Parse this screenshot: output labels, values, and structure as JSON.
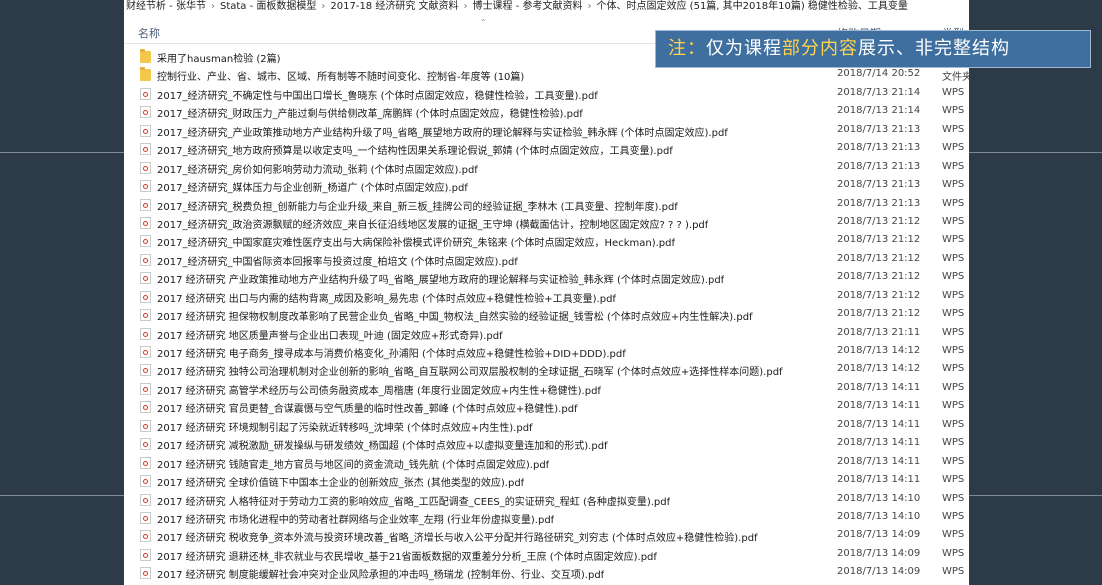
{
  "breadcrumb": [
    "财经节析 - 张华节",
    "Stata - 面板数据模型",
    "2017-18 经济研究 文献资料",
    "博士课程 - 参考文献资料",
    "个体、时点固定效应 (51篇, 其中2018年10篇) 稳健性检验、工具变量"
  ],
  "columns": {
    "name": "名称",
    "date": "修改日期",
    "type": "类型"
  },
  "note": {
    "prefix": "注：",
    "part1": "仅为课程",
    "highlight": "部分内容",
    "part2": "展示、非完整结构"
  },
  "files": [
    {
      "icon": "folder-icon",
      "name": "采用了hausman检验 (2篇)",
      "date": "",
      "type": ""
    },
    {
      "icon": "folder-icon",
      "name": "控制行业、产业、省、城市、区域、所有制等不随时间变化、控制省-年度等 (10篇)",
      "date": "2018/7/14 20:52",
      "type": "文件夹"
    },
    {
      "icon": "pdf-icon",
      "name": "2017_经济研究_不确定性与中国出口增长_鲁晓东 (个体时点固定效应，稳健性检验，工具变量).pdf",
      "date": "2018/7/13 21:14",
      "type": "WPS"
    },
    {
      "icon": "pdf-icon",
      "name": "2017_经济研究_财政压力_产能过剩与供给侧改革_席鹏辉 (个体时点固定效应，稳健性检验).pdf",
      "date": "2018/7/13 21:14",
      "type": "WPS"
    },
    {
      "icon": "pdf-icon",
      "name": "2017_经济研究_产业政策推动地方产业结构升级了吗_省略_展望地方政府的理论解释与实证检验_韩永辉 (个体时点固定效应).pdf",
      "date": "2018/7/13 21:13",
      "type": "WPS"
    },
    {
      "icon": "pdf-icon",
      "name": "2017_经济研究_地方政府预算是以收定支吗_一个结构性因果关系理论假说_郭婧 (个体时点固定效应，工具变量).pdf",
      "date": "2018/7/13 21:13",
      "type": "WPS"
    },
    {
      "icon": "pdf-icon",
      "name": "2017_经济研究_房价如何影响劳动力流动_张莉 (个体时点固定效应).pdf",
      "date": "2018/7/13 21:13",
      "type": "WPS"
    },
    {
      "icon": "pdf-icon",
      "name": "2017_经济研究_媒体压力与企业创新_杨道广 (个体时点固定效应).pdf",
      "date": "2018/7/13 21:13",
      "type": "WPS"
    },
    {
      "icon": "pdf-icon",
      "name": "2017_经济研究_税费负担_创新能力与企业升级_来自_新三板_挂牌公司的经验证据_李林木 (工具变量、控制年度).pdf",
      "date": "2018/7/13 21:13",
      "type": "WPS"
    },
    {
      "icon": "pdf-icon",
      "name": "2017_经济研究_政治资源飘赋的经济效应_来自长征沿线地区发展的证据_王守坤 (横截面估计，控制地区固定效应? ? ? ).pdf",
      "date": "2018/7/13 21:12",
      "type": "WPS"
    },
    {
      "icon": "pdf-icon",
      "name": "2017_经济研究_中国家庭灾难性医疗支出与大病保险补偿模式评价研究_朱铭来 (个体时点固定效应，Heckman).pdf",
      "date": "2018/7/13 21:12",
      "type": "WPS"
    },
    {
      "icon": "pdf-icon",
      "name": "2017_经济研究_中国省际资本回报率与投资过度_柏培文 (个体时点固定效应).pdf",
      "date": "2018/7/13 21:12",
      "type": "WPS"
    },
    {
      "icon": "pdf-icon",
      "name": "2017 经济研究 产业政策推动地方产业结构升级了吗_省略_展望地方政府的理论解释与实证检验_韩永辉 (个体时点固定效应).pdf",
      "date": "2018/7/13 21:12",
      "type": "WPS"
    },
    {
      "icon": "pdf-icon",
      "name": "2017 经济研究 出口与内需的结构背离_成因及影响_易先忠 (个体时点效应+稳健性检验+工具变量).pdf",
      "date": "2018/7/13 21:12",
      "type": "WPS"
    },
    {
      "icon": "pdf-icon",
      "name": "2017 经济研究 担保物权制度改革影响了民营企业负_省略_中国_物权法_自然实验的经验证据_钱雪松 (个体时点效应+内生性解决).pdf",
      "date": "2018/7/13 21:12",
      "type": "WPS"
    },
    {
      "icon": "pdf-icon",
      "name": "2017 经济研究 地区质量声誉与企业出口表现_叶迪 (固定效应+形式奇异).pdf",
      "date": "2018/7/13 21:11",
      "type": "WPS"
    },
    {
      "icon": "pdf-icon",
      "name": "2017 经济研究 电子商务_搜寻成本与消费价格变化_孙浦阳 (个体时点效应+稳健性检验+DID+DDD).pdf",
      "date": "2018/7/13 14:12",
      "type": "WPS"
    },
    {
      "icon": "pdf-icon",
      "name": "2017 经济研究 独特公司治理机制对企业创新的影响_省略_自互联网公司双层股权制的全球证据_石晓军 (个体时点效应+选择性样本问题).pdf",
      "date": "2018/7/13 14:12",
      "type": "WPS"
    },
    {
      "icon": "pdf-icon",
      "name": "2017 经济研究 高管学术经历与公司债务融资成本_周楷唐 (年度行业固定效应+内生性+稳健性).pdf",
      "date": "2018/7/13 14:11",
      "type": "WPS"
    },
    {
      "icon": "pdf-icon",
      "name": "2017 经济研究 官员更替_合谋震慑与空气质量的临时性改善_郭峰 (个体时点效应+稳健性).pdf",
      "date": "2018/7/13 14:11",
      "type": "WPS"
    },
    {
      "icon": "pdf-icon",
      "name": "2017 经济研究 环境规制引起了污染就近转移吗_沈坤荣 (个体时点效应+内生性).pdf",
      "date": "2018/7/13 14:11",
      "type": "WPS"
    },
    {
      "icon": "pdf-icon",
      "name": "2017 经济研究 减税激励_研发操纵与研发绩效_杨国超 (个体时点效应+以虚拟变量连加和的形式).pdf",
      "date": "2018/7/13 14:11",
      "type": "WPS"
    },
    {
      "icon": "pdf-icon",
      "name": "2017 经济研究 钱随官走_地方官员与地区间的资金流动_钱先航 (个体时点固定效应).pdf",
      "date": "2018/7/13 14:11",
      "type": "WPS"
    },
    {
      "icon": "pdf-icon",
      "name": "2017 经济研究 全球价值链下中国本土企业的创新效应_张杰 (其他类型的效应).pdf",
      "date": "2018/7/13 14:11",
      "type": "WPS"
    },
    {
      "icon": "pdf-icon",
      "name": "2017 经济研究 人格特征对于劳动力工资的影响效应_省略_工匹配调查_CEES_的实证研究_程虹 (各种虚拟变量).pdf",
      "date": "2018/7/13 14:10",
      "type": "WPS"
    },
    {
      "icon": "pdf-icon",
      "name": "2017 经济研究 市场化进程中的劳动者社群网络与企业效率_左翔 (行业年份虚拟变量).pdf",
      "date": "2018/7/13 14:10",
      "type": "WPS"
    },
    {
      "icon": "pdf-icon",
      "name": "2017 经济研究 税收竞争_资本外流与投资环境改善_省略_济增长与收入公平分配并行路径研究_刘穷志 (个体时点效应+稳健性检验).pdf",
      "date": "2018/7/13 14:09",
      "type": "WPS"
    },
    {
      "icon": "pdf-icon",
      "name": "2017 经济研究 退耕还林_非农就业与农民增收_基于21省面板数据的双重差分分析_王庶 (个体时点固定效应).pdf",
      "date": "2018/7/13 14:09",
      "type": "WPS"
    },
    {
      "icon": "pdf-icon",
      "name": "2017 经济研究 制度能缓解社会冲突对企业风险承担的冲击吗_杨瑞龙 (控制年份、行业、交互项).pdf",
      "date": "2018/7/13 14:09",
      "type": "WPS"
    }
  ]
}
